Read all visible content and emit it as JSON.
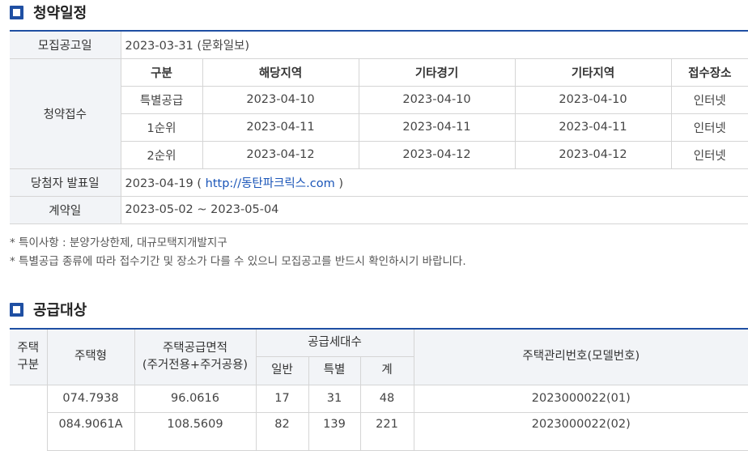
{
  "schedule": {
    "title": "청약일정",
    "announcement": {
      "label": "모집공고일",
      "value": "2023-03-31 (문화일보)"
    },
    "reception": {
      "label": "청약접수",
      "headers": [
        "구분",
        "해당지역",
        "기타경기",
        "기타지역",
        "접수장소"
      ],
      "rows": [
        [
          "특별공급",
          "2023-04-10",
          "2023-04-10",
          "2023-04-10",
          "인터넷"
        ],
        [
          "1순위",
          "2023-04-11",
          "2023-04-11",
          "2023-04-11",
          "인터넷"
        ],
        [
          "2순위",
          "2023-04-12",
          "2023-04-12",
          "2023-04-12",
          "인터넷"
        ]
      ]
    },
    "winner": {
      "label": "당첨자 발표일",
      "date": "2023-04-19 (",
      "link": "http://동탄파크릭스.com",
      "close": ")"
    },
    "contract": {
      "label": "계약일",
      "value": "2023-05-02 ~ 2023-05-04"
    },
    "notes": [
      "* 특이사항 : 분양가상한제, 대규모택지개발지구",
      "* 특별공급 종류에 따라 접수기간 및 장소가 다를 수 있으니 모집공고를 반드시 확인하시기 바랍니다."
    ]
  },
  "supply": {
    "title": "공급대상",
    "headers": {
      "type_group_line1": "주택",
      "type_group_line2": "구분",
      "housing_type": "주택형",
      "area_line1": "주택공급면적",
      "area_line2": "(주거전용+주거공용)",
      "units": "공급세대수",
      "general": "일반",
      "special": "특별",
      "total": "계",
      "mgmt_no": "주택관리번호(모델번호)"
    },
    "rows": [
      {
        "type": "074.7938",
        "area": "96.0616",
        "general": "17",
        "special": "31",
        "total": "48",
        "mgmt": "2023000022(01)"
      },
      {
        "type": "084.9061A",
        "area": "108.5609",
        "general": "82",
        "special": "139",
        "total": "221",
        "mgmt": "2023000022(02)"
      }
    ]
  },
  "colors": {
    "accent": "#1f4fa3",
    "header_bg": "#f2f4f7",
    "link": "#1a55b8"
  }
}
